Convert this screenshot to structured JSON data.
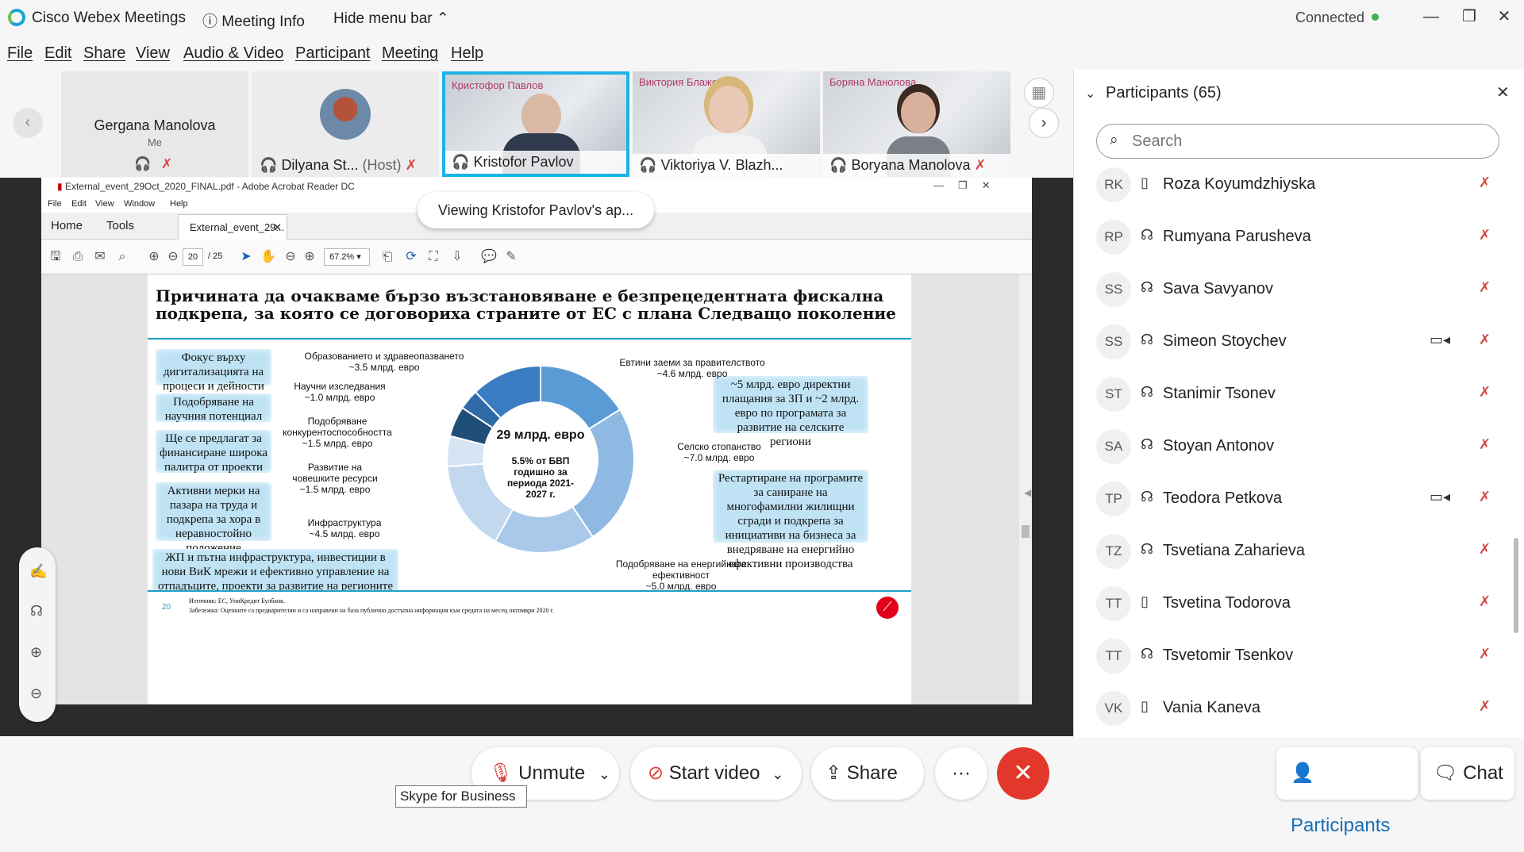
{
  "titlebar": {
    "app_title": "Cisco Webex Meetings",
    "meeting_info": "Meeting Info",
    "hide_menu": "Hide menu bar",
    "status": "Connected",
    "status_color": "#3cb050"
  },
  "menubar": [
    "File",
    "Edit",
    "Share",
    "View",
    "Audio & Video",
    "Participant",
    "Meeting",
    "Help"
  ],
  "videos": {
    "self": {
      "name": "Gergana Manolova",
      "sub": "Me"
    },
    "tiles": [
      {
        "name": "Dilyana St...",
        "role": "(Host)"
      },
      {
        "name": "Kristofor Pavlov",
        "overlay": "Кристофор Павлов",
        "active": true
      },
      {
        "name": "Viktoriya V. Blazh...",
        "overlay": "Виктория Блажова"
      },
      {
        "name": "Boryana Manolova",
        "overlay": "Боряна Манолова"
      }
    ]
  },
  "share": {
    "viewing_tip": "Viewing Kristofor Pavlov's ap...",
    "acrobat": {
      "window_title": "External_event_29Oct_2020_FINAL.pdf - Adobe Acrobat Reader DC",
      "menu": [
        "File",
        "Edit",
        "View",
        "Window",
        "Help"
      ],
      "tabs": [
        "Home",
        "Tools",
        "External_event_29..."
      ],
      "page_current": "20",
      "page_total": "/ 25",
      "zoom": "67.2%"
    },
    "slide": {
      "title_line1": "Причината да очакваме бързо възстановяване е безпрецедентната фискална",
      "title_line2": "подкрепа, за която се договориха страните от ЕС с плана Следващо поколение",
      "left_callouts": [
        "Фокус върху дигитализацията на процеси и дейности",
        "Подобряване на научния потенциал",
        "Ще се предлагат за финансиране широка палитра от проекти",
        "Активни мерки на пазара на труда и подкрепа за хора в неравностойно положение",
        "ЖП и пътна инфраструктура, инвестиции в нови ВиК мрежи и ефективно управление на отпадъците, проекти за развитие на регионите"
      ],
      "right_callouts": [
        "~5 млрд. евро директни плащания за ЗП и ~2 млрд. евро по програмата за развитие на селските региони",
        "Рестартиране на програмите за саниране на многофамилни жилищни сгради и подкрепа за инициативи на бизнеса за внедряване на енергийно ефективни производства"
      ],
      "donut_center_main": "29 млрд. евро",
      "donut_center_sub": "5.5% от БВП годишно за периода 2021-2027 г.",
      "segments": [
        {
          "label": "Евтини заеми за правителството",
          "value": "~4.6 млрд. евро",
          "amount": 4.6,
          "color": "#5b9bd5"
        },
        {
          "label": "Селско стопанство",
          "value": "~7.0 млрд. евро",
          "amount": 7.0,
          "color": "#8fb9e3"
        },
        {
          "label": "Подобряване на енергийната ефективност",
          "value": "~5.0 млрд. евро",
          "amount": 5.0,
          "color": "#a9c8ea"
        },
        {
          "label": "Инфраструктура",
          "value": "~4.5 млрд. евро",
          "amount": 4.5,
          "color": "#c3d8ef"
        },
        {
          "label": "Развитие на човешките ресурси",
          "value": "~1.5 млрд. евро",
          "amount": 1.5,
          "color": "#d6e4f4"
        },
        {
          "label": "Подобряване конкурентоспособността",
          "value": "~1.5 млрд. евро",
          "amount": 1.5,
          "color": "#1f4e79"
        },
        {
          "label": "Научни изследвания",
          "value": "~1.0 млрд. евро",
          "amount": 1.0,
          "color": "#2e6aa8"
        },
        {
          "label": "Образованието и здравеопазването",
          "value": "~3.5 млрд. евро",
          "amount": 3.5,
          "color": "#3a7cc3"
        }
      ],
      "footer_page": "20",
      "footer_source": "Източник: ЕС, УниКредит Булбанк.",
      "footer_note": "Забележка: Оценките са предварителни и са направени на база публично достъпна информация към средата на месец октомври 2020 г."
    }
  },
  "participants": {
    "title": "Participants (65)",
    "search_placeholder": "Search",
    "list": [
      {
        "initials": "RK",
        "name": "Roza Koyumdzhiyska",
        "device": "phone",
        "video": false
      },
      {
        "initials": "RP",
        "name": "Rumyana Parusheva",
        "device": "headset",
        "video": false
      },
      {
        "initials": "SS",
        "name": "Sava Savyanov",
        "device": "headset",
        "video": false
      },
      {
        "initials": "SS",
        "name": "Simeon Stoychev",
        "device": "headset",
        "video": true
      },
      {
        "initials": "ST",
        "name": "Stanimir Tsonev",
        "device": "headset",
        "video": false
      },
      {
        "initials": "SA",
        "name": "Stoyan Antonov",
        "device": "headset",
        "video": false
      },
      {
        "initials": "TP",
        "name": "Teodora Petkova",
        "device": "headset",
        "video": true
      },
      {
        "initials": "TZ",
        "name": "Tsvetiana Zaharieva",
        "device": "headset",
        "video": false
      },
      {
        "initials": "TT",
        "name": "Tsvetina Todorova",
        "device": "phone",
        "video": false
      },
      {
        "initials": "TT",
        "name": "Tsvetomir Tsenkov",
        "device": "headset",
        "video": false
      },
      {
        "initials": "VK",
        "name": "Vania Kaneva",
        "device": "phone",
        "video": false
      }
    ]
  },
  "bottombar": {
    "unmute": "Unmute",
    "start_video": "Start video",
    "share": "Share",
    "more": "···",
    "participants": "Participants",
    "chat": "Chat",
    "end_color": "#e2382b"
  },
  "tooltip": "Skype for Business"
}
